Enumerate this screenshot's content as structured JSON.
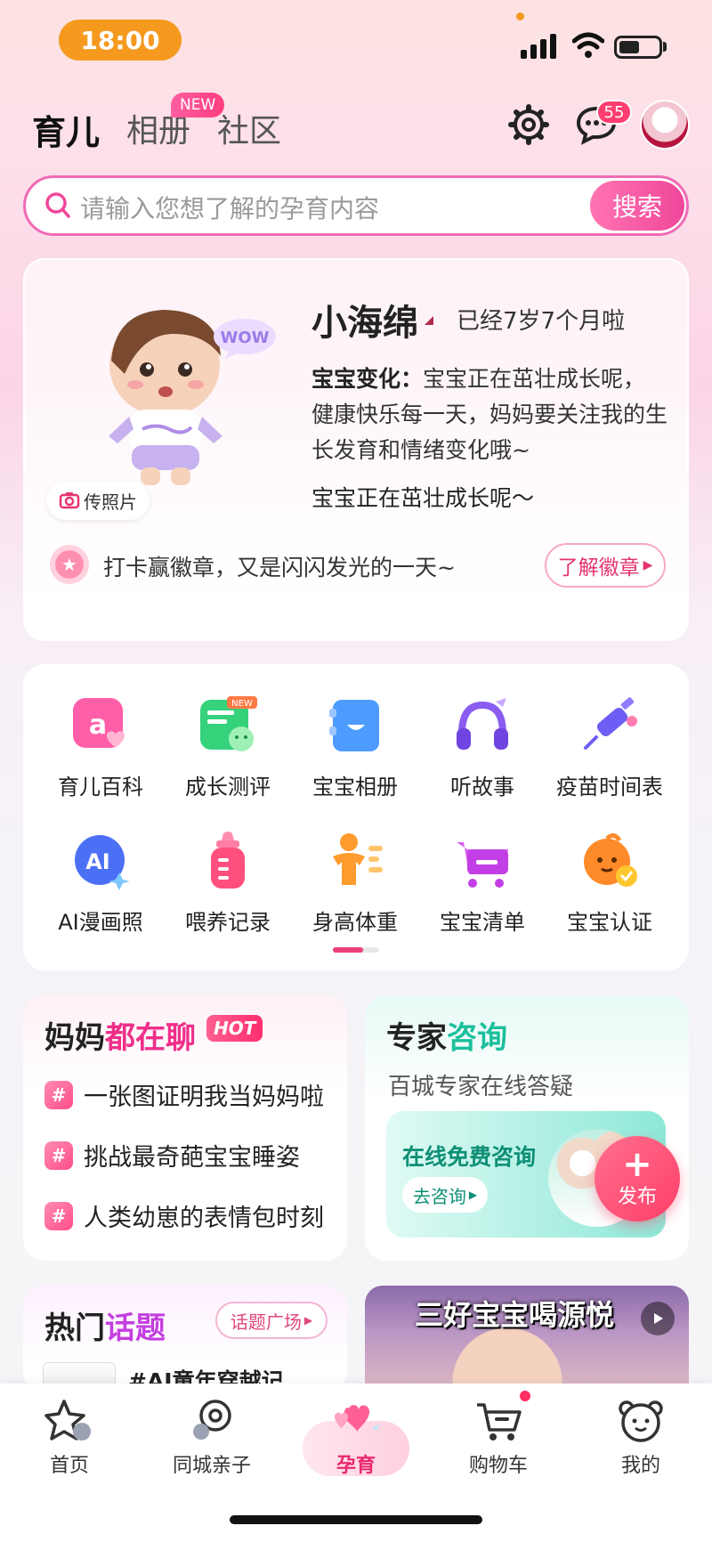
{
  "status_bar": {
    "time": "18:00"
  },
  "header": {
    "tabs": [
      {
        "label": "育儿",
        "active": true
      },
      {
        "label": "相册",
        "active": false
      },
      {
        "label": "社区",
        "active": false
      }
    ],
    "new_badge": "NEW",
    "message_count": "55"
  },
  "search": {
    "placeholder": "请输入您想了解的孕育内容",
    "button_label": "搜索"
  },
  "baby_card": {
    "name": "小海绵",
    "age": "已经7岁7个月啦",
    "change_label": "宝宝变化：",
    "change_text": "宝宝正在茁壮成长呢，健康快乐每一天，妈妈要关注我的生长发育和情绪变化哦~",
    "status_text": "宝宝正在茁壮成长呢～",
    "photo_button": "传照片",
    "bubble_text": "WOW",
    "checkin_text": "打卡赢徽章，又是闪闪发光的一天~",
    "learn_button": "了解徽章"
  },
  "features": [
    {
      "label": "育儿百科",
      "icon": "encyclopedia-icon",
      "badge": ""
    },
    {
      "label": "成长测评",
      "icon": "growth-assessment-icon",
      "badge": "NEW"
    },
    {
      "label": "宝宝相册",
      "icon": "album-icon",
      "badge": ""
    },
    {
      "label": "听故事",
      "icon": "headphones-icon",
      "badge": ""
    },
    {
      "label": "疫苗时间表",
      "icon": "vaccine-syringe-icon",
      "badge": ""
    },
    {
      "label": "AI漫画照",
      "icon": "ai-comic-icon",
      "badge": ""
    },
    {
      "label": "喂养记录",
      "icon": "baby-bottle-icon",
      "badge": ""
    },
    {
      "label": "身高体重",
      "icon": "height-weight-icon",
      "badge": ""
    },
    {
      "label": "宝宝清单",
      "icon": "shopping-cart-icon",
      "badge": ""
    },
    {
      "label": "宝宝认证",
      "icon": "baby-verify-icon",
      "badge": ""
    }
  ],
  "mama_chat": {
    "title_a": "妈妈",
    "title_b": "都在聊",
    "hot_badge": "HOT",
    "topics": [
      "一张图证明我当妈妈啦",
      "挑战最奇葩宝宝睡姿",
      "人类幼崽的表情包时刻"
    ]
  },
  "expert": {
    "title_a": "专家",
    "title_b": "咨询",
    "subtitle": "百城专家在线答疑",
    "free_consult": "在线免费咨询",
    "go_consult": "去咨询"
  },
  "publish_button": {
    "plus": "+",
    "label": "发布"
  },
  "hot_topics": {
    "title_a": "热门",
    "title_b": "话题",
    "square_button": "话题广场",
    "first_topic": "#AI童年穿越记"
  },
  "video": {
    "title": "三好宝宝喝源悦"
  },
  "bottom_nav": [
    {
      "label": "首页",
      "icon": "home-star-icon",
      "active": false
    },
    {
      "label": "同城亲子",
      "icon": "location-icon",
      "active": false
    },
    {
      "label": "孕育",
      "icon": "hearts-icon",
      "active": true
    },
    {
      "label": "购物车",
      "icon": "cart-icon",
      "active": false
    },
    {
      "label": "我的",
      "icon": "bear-face-icon",
      "active": false
    }
  ],
  "colors": {
    "accent_pink": "#ef2f8a",
    "status_orange": "#f59a1f",
    "teal": "#1bbf9c"
  }
}
